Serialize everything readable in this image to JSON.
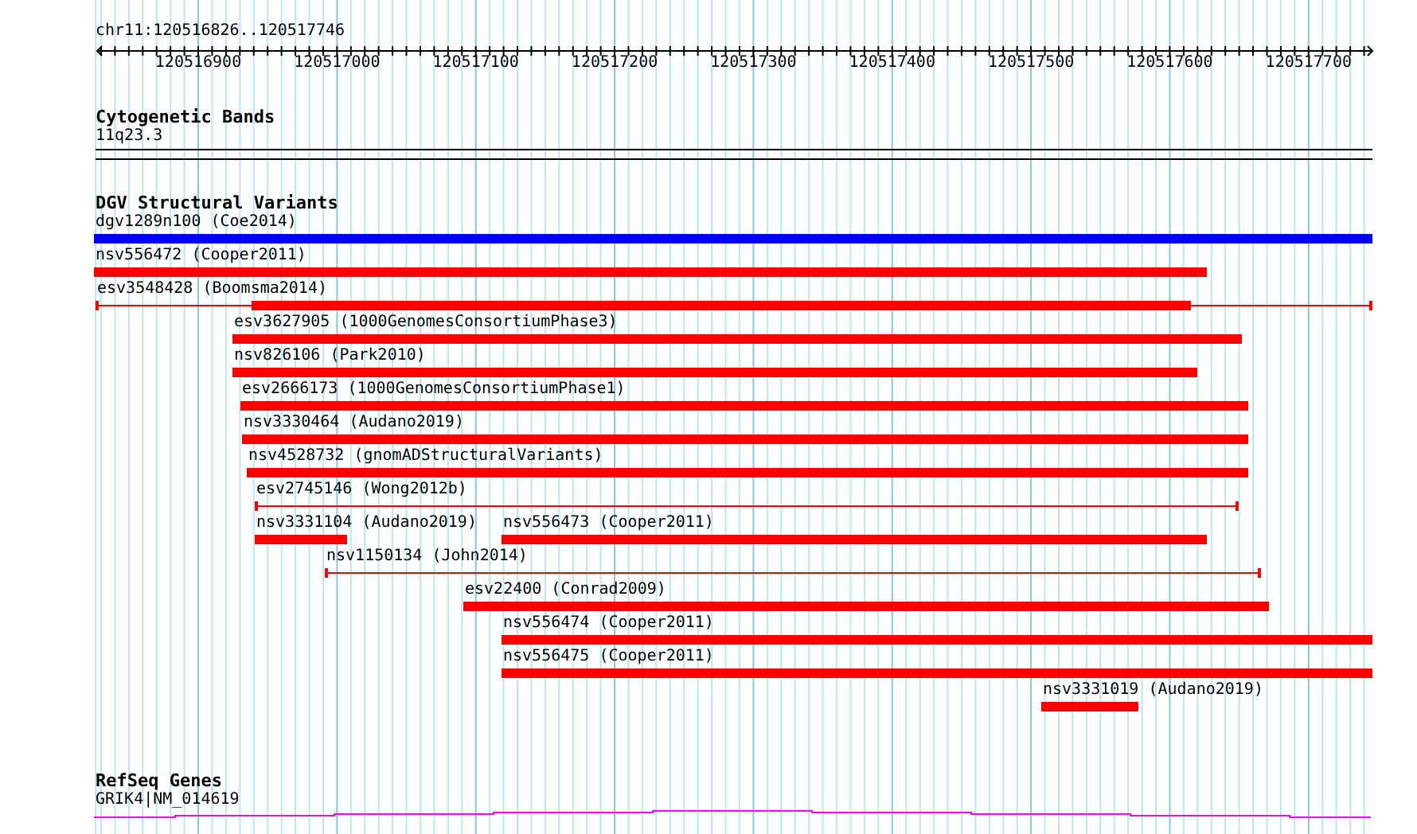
{
  "ruler": {
    "location": "chr11:120516826..120517746",
    "ticks": [
      "120516900",
      "120517000",
      "120517100",
      "120517200",
      "120517300",
      "120517400",
      "120517500",
      "120517600",
      "120517700"
    ]
  },
  "tracks": [
    {
      "title": "Cytogenetic Bands",
      "kind": "bands",
      "features": [
        {
          "label": "11q23.3",
          "kind": "band"
        }
      ]
    },
    {
      "title": "DGV Structural Variants",
      "kind": "variants",
      "features": [
        {
          "label": "dgv1289n100 (Coe2014)",
          "kind": "solid",
          "color": "#0000ff"
        },
        {
          "label": "nsv556472 (Cooper2011)",
          "kind": "solid",
          "color": "#ff0000"
        },
        {
          "label": "esv3548428 (Boomsma2014)",
          "kind": "line_core",
          "color": "#ff0000"
        },
        {
          "label": "esv3627905 (1000GenomesConsortiumPhase3)",
          "kind": "solid",
          "color": "#ff0000"
        },
        {
          "label": "nsv826106 (Park2010)",
          "kind": "solid",
          "color": "#ff0000"
        },
        {
          "label": "esv2666173 (1000GenomesConsortiumPhase1)",
          "kind": "solid",
          "color": "#ff0000"
        },
        {
          "label": "nsv3330464 (Audano2019)",
          "kind": "solid",
          "color": "#ff0000"
        },
        {
          "label": "nsv4528732 (gnomADStructuralVariants)",
          "kind": "solid",
          "color": "#ff0000"
        },
        {
          "label": "esv2745146 (Wong2012b)",
          "kind": "line",
          "color": "#ff0000"
        },
        {
          "label": "nsv3331104 (Audano2019)",
          "kind": "solid",
          "color": "#ff0000"
        },
        {
          "label": "nsv556473 (Cooper2011)",
          "kind": "solid",
          "color": "#ff0000"
        },
        {
          "label": "nsv1150134 (John2014)",
          "kind": "line",
          "color": "#ff0000"
        },
        {
          "label": "esv22400 (Conrad2009)",
          "kind": "solid",
          "color": "#ff0000"
        },
        {
          "label": "nsv556474 (Cooper2011)",
          "kind": "solid",
          "color": "#ff0000"
        },
        {
          "label": "nsv556475 (Cooper2011)",
          "kind": "solid",
          "color": "#ff0000"
        },
        {
          "label": "nsv3331019 (Audano2019)",
          "kind": "solid",
          "color": "#ff0000"
        }
      ]
    },
    {
      "title": "RefSeq Genes",
      "kind": "genes",
      "features": [
        {
          "label": "GRIK4|NM_014619",
          "kind": "gene"
        }
      ]
    }
  ]
}
